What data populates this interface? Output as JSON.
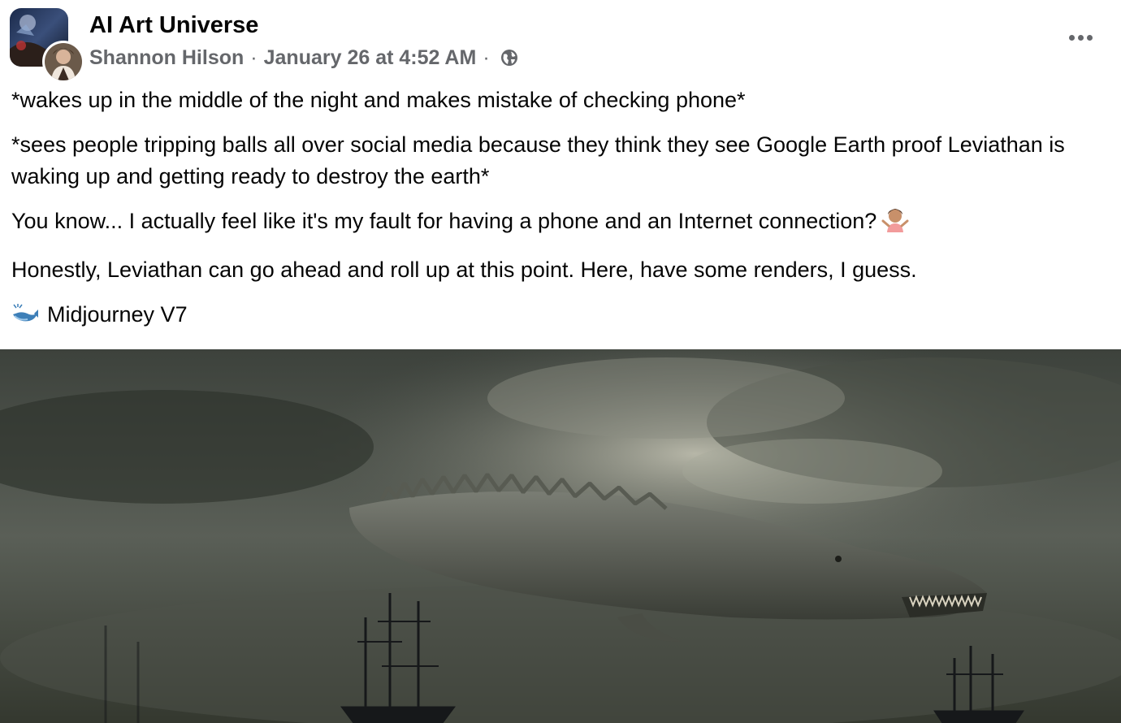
{
  "post": {
    "group_name": "AI Art Universe",
    "author": "Shannon Hilson",
    "separator": "·",
    "timestamp": "January 26 at 4:52 AM",
    "privacy_icon": "globe-icon",
    "more_icon": "more-options-icon",
    "paragraphs": {
      "p1": "*wakes up in the middle of the night and makes mistake of checking phone*",
      "p2": "*sees people tripping balls all over social media because they think they see Google Earth proof Leviathan is waking up and getting ready to destroy the earth*",
      "p3": "You know... I actually feel like it's my fault for having a phone and an Internet connection?",
      "p3_emoji": "🤷🏽‍♀️",
      "p4": "Honestly, Leviathan can go ahead and roll up at this point. Here, have some renders, I guess.",
      "p5_emoji": "🐋",
      "p5": "Midjourney V7"
    },
    "image_icon": "leviathan-render-image"
  },
  "colors": {
    "text_primary": "#050505",
    "text_secondary": "#65676b",
    "background": "#ffffff"
  }
}
